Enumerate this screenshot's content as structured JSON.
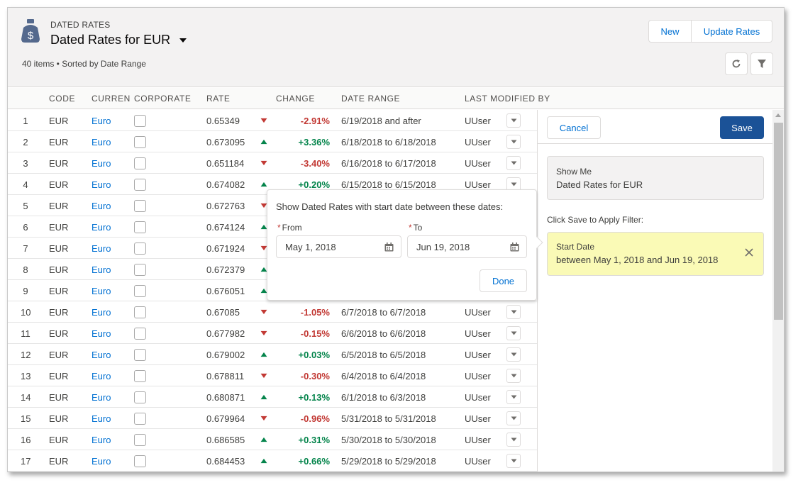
{
  "header": {
    "object_type": "DATED RATES",
    "title": "Dated Rates for EUR",
    "meta": "40 items • Sorted by Date Range",
    "new_label": "New",
    "update_label": "Update Rates"
  },
  "columns": [
    "CODE",
    "CURREN",
    "CORPORATE",
    "RATE",
    "CHANGE",
    "DATE RANGE",
    "LAST MODIFIED BY"
  ],
  "rows": [
    {
      "num": "1",
      "code": "EUR",
      "currency": "Euro",
      "rate": "0.65349",
      "dir": "down",
      "change": "-2.91%",
      "range": "6/19/2018 and after",
      "user": "UUser"
    },
    {
      "num": "2",
      "code": "EUR",
      "currency": "Euro",
      "rate": "0.673095",
      "dir": "up",
      "change": "+3.36%",
      "range": "6/18/2018 to 6/18/2018",
      "user": "UUser"
    },
    {
      "num": "3",
      "code": "EUR",
      "currency": "Euro",
      "rate": "0.651184",
      "dir": "down",
      "change": "-3.40%",
      "range": "6/16/2018 to 6/17/2018",
      "user": "UUser"
    },
    {
      "num": "4",
      "code": "EUR",
      "currency": "Euro",
      "rate": "0.674082",
      "dir": "up",
      "change": "+0.20%",
      "range": "6/15/2018 to 6/15/2018",
      "user": "UUser"
    },
    {
      "num": "5",
      "code": "EUR",
      "currency": "Euro",
      "rate": "0.672763",
      "dir": "down",
      "change": "",
      "range": "",
      "user": ""
    },
    {
      "num": "6",
      "code": "EUR",
      "currency": "Euro",
      "rate": "0.674124",
      "dir": "up",
      "change": "",
      "range": "",
      "user": ""
    },
    {
      "num": "7",
      "code": "EUR",
      "currency": "Euro",
      "rate": "0.671924",
      "dir": "down",
      "change": "",
      "range": "",
      "user": ""
    },
    {
      "num": "8",
      "code": "EUR",
      "currency": "Euro",
      "rate": "0.672379",
      "dir": "up",
      "change": "",
      "range": "",
      "user": ""
    },
    {
      "num": "9",
      "code": "EUR",
      "currency": "Euro",
      "rate": "0.676051",
      "dir": "up",
      "change": "",
      "range": "",
      "user": ""
    },
    {
      "num": "10",
      "code": "EUR",
      "currency": "Euro",
      "rate": "0.67085",
      "dir": "down",
      "change": "-1.05%",
      "range": "6/7/2018 to 6/7/2018",
      "user": "UUser"
    },
    {
      "num": "11",
      "code": "EUR",
      "currency": "Euro",
      "rate": "0.677982",
      "dir": "down",
      "change": "-0.15%",
      "range": "6/6/2018 to 6/6/2018",
      "user": "UUser"
    },
    {
      "num": "12",
      "code": "EUR",
      "currency": "Euro",
      "rate": "0.679002",
      "dir": "up",
      "change": "+0.03%",
      "range": "6/5/2018 to 6/5/2018",
      "user": "UUser"
    },
    {
      "num": "13",
      "code": "EUR",
      "currency": "Euro",
      "rate": "0.678811",
      "dir": "down",
      "change": "-0.30%",
      "range": "6/4/2018 to 6/4/2018",
      "user": "UUser"
    },
    {
      "num": "14",
      "code": "EUR",
      "currency": "Euro",
      "rate": "0.680871",
      "dir": "up",
      "change": "+0.13%",
      "range": "6/1/2018 to 6/3/2018",
      "user": "UUser"
    },
    {
      "num": "15",
      "code": "EUR",
      "currency": "Euro",
      "rate": "0.679964",
      "dir": "down",
      "change": "-0.96%",
      "range": "5/31/2018 to 5/31/2018",
      "user": "UUser"
    },
    {
      "num": "16",
      "code": "EUR",
      "currency": "Euro",
      "rate": "0.686585",
      "dir": "up",
      "change": "+0.31%",
      "range": "5/30/2018 to 5/30/2018",
      "user": "UUser"
    },
    {
      "num": "17",
      "code": "EUR",
      "currency": "Euro",
      "rate": "0.684453",
      "dir": "up",
      "change": "+0.66%",
      "range": "5/29/2018 to 5/29/2018",
      "user": "UUser"
    }
  ],
  "filter_panel": {
    "cancel_label": "Cancel",
    "save_label": "Save",
    "show_me_label": "Show Me",
    "show_me_value": "Dated Rates for EUR",
    "apply_hint": "Click Save to Apply Filter:",
    "filter_label": "Start Date",
    "filter_value": "between May 1, 2018 and Jun 19, 2018"
  },
  "popover": {
    "title": "Show Dated Rates with start date between these dates:",
    "required_mark": "*",
    "from_label": "From",
    "from_value": "May 1, 2018",
    "to_label": "To",
    "to_value": "Jun 19, 2018",
    "done_label": "Done"
  },
  "colors": {
    "link": "#0070d2",
    "positive": "#04844b",
    "negative": "#c23934",
    "save_button": "#1b5297",
    "filter_highlight": "#fafab6"
  },
  "icons": {
    "object": "money-bag-icon",
    "refresh": "refresh-icon",
    "filter": "filter-icon",
    "calendar": "calendar-icon",
    "close": "close-icon",
    "row_menu": "chevron-down-icon"
  }
}
